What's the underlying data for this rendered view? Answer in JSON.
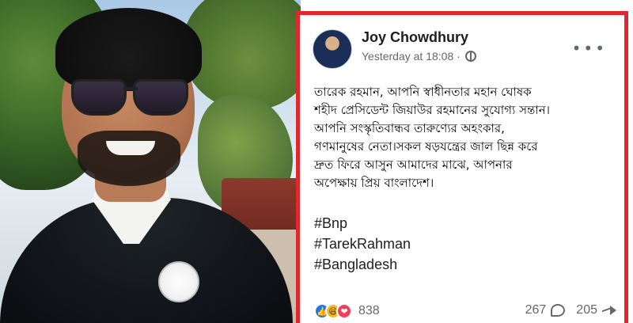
{
  "post": {
    "author": "Joy Chowdhury",
    "timestamp": "Yesterday at 18:08 ·",
    "text_lines": [
      "তারেক রহমান, আপনি স্বাধীনতার মহান ঘোষক",
      "শহীদ প্রেসিডেন্ট জিয়াউর রহমানের সুযোগ্য সন্তান।",
      "আপনি সংস্কৃতিবান্ধব তারুণ্যের অহংকার,",
      "গণমানুষের নেতা।সকল ষড়যন্ত্রের জাল ছিন্ন করে",
      "দ্রুত ফিরে আসুন আমাদের মাঝে, আপনার",
      "অপেক্ষায় প্রিয় বাংলাদেশ।"
    ],
    "hashtags": [
      "#Bnp",
      "#TarekRahman",
      "#Bangladesh"
    ],
    "reaction_count": "838",
    "comment_count": "267",
    "share_count": "205",
    "icons": [
      "globe-icon",
      "more-options-icon",
      "like-reaction-icon",
      "haha-reaction-icon",
      "love-reaction-icon",
      "comment-icon",
      "share-icon"
    ],
    "colors": {
      "frame_red": "#e1272d",
      "text_dark": "#1c1e21",
      "meta_gray": "#65676b",
      "like_blue": "#1877f2",
      "love_red": "#f33e58",
      "haha_yellow": "#f7b928"
    }
  }
}
